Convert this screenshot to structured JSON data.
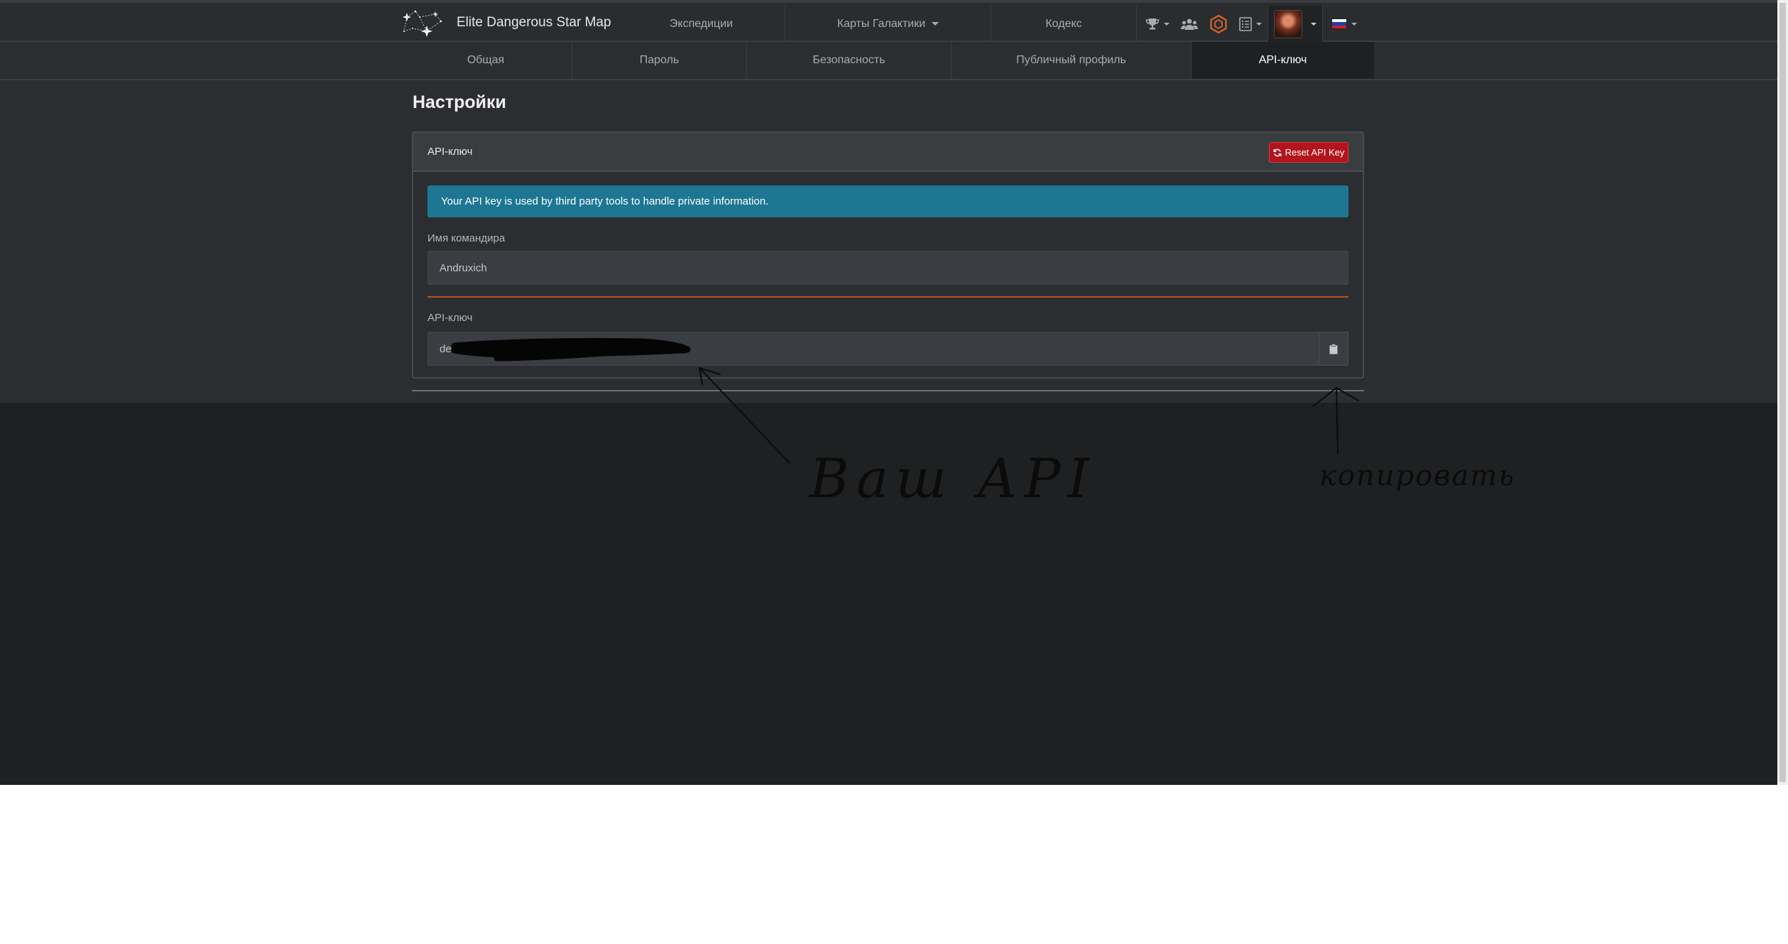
{
  "app": {
    "title": "Elite Dangerous Star Map"
  },
  "nav": {
    "expeditions": "Экспедиции",
    "galaxy_maps": "Карты Галактики",
    "codex": "Кодекс"
  },
  "nav_icons": [
    "trophy-icon",
    "users-icon",
    "hexagon-icon",
    "list-icon",
    "avatar",
    "flag-ru-icon"
  ],
  "tabs": {
    "general": "Общая",
    "password": "Пароль",
    "security": "Безопасность",
    "public_profile": "Публичный профиль",
    "api_key": "API-ключ"
  },
  "active_tab": "API-ключ",
  "page": {
    "title": "Настройки"
  },
  "card": {
    "title": "API-ключ",
    "reset_button": "Reset API Key",
    "alert": "Your API key is used by third party tools to handle private information.",
    "commander_label": "Имя командира",
    "commander_value": "Andruxich",
    "api_label": "API-ключ",
    "api_value_visible": "de"
  },
  "annotations": {
    "text_left": "Ваш API",
    "text_right": "копировать"
  },
  "colors": {
    "background": "#1e2022",
    "panel": "#2b2d30",
    "alert": "#1d7793",
    "danger": "#b3141c",
    "accent_orange": "#d8672a"
  }
}
